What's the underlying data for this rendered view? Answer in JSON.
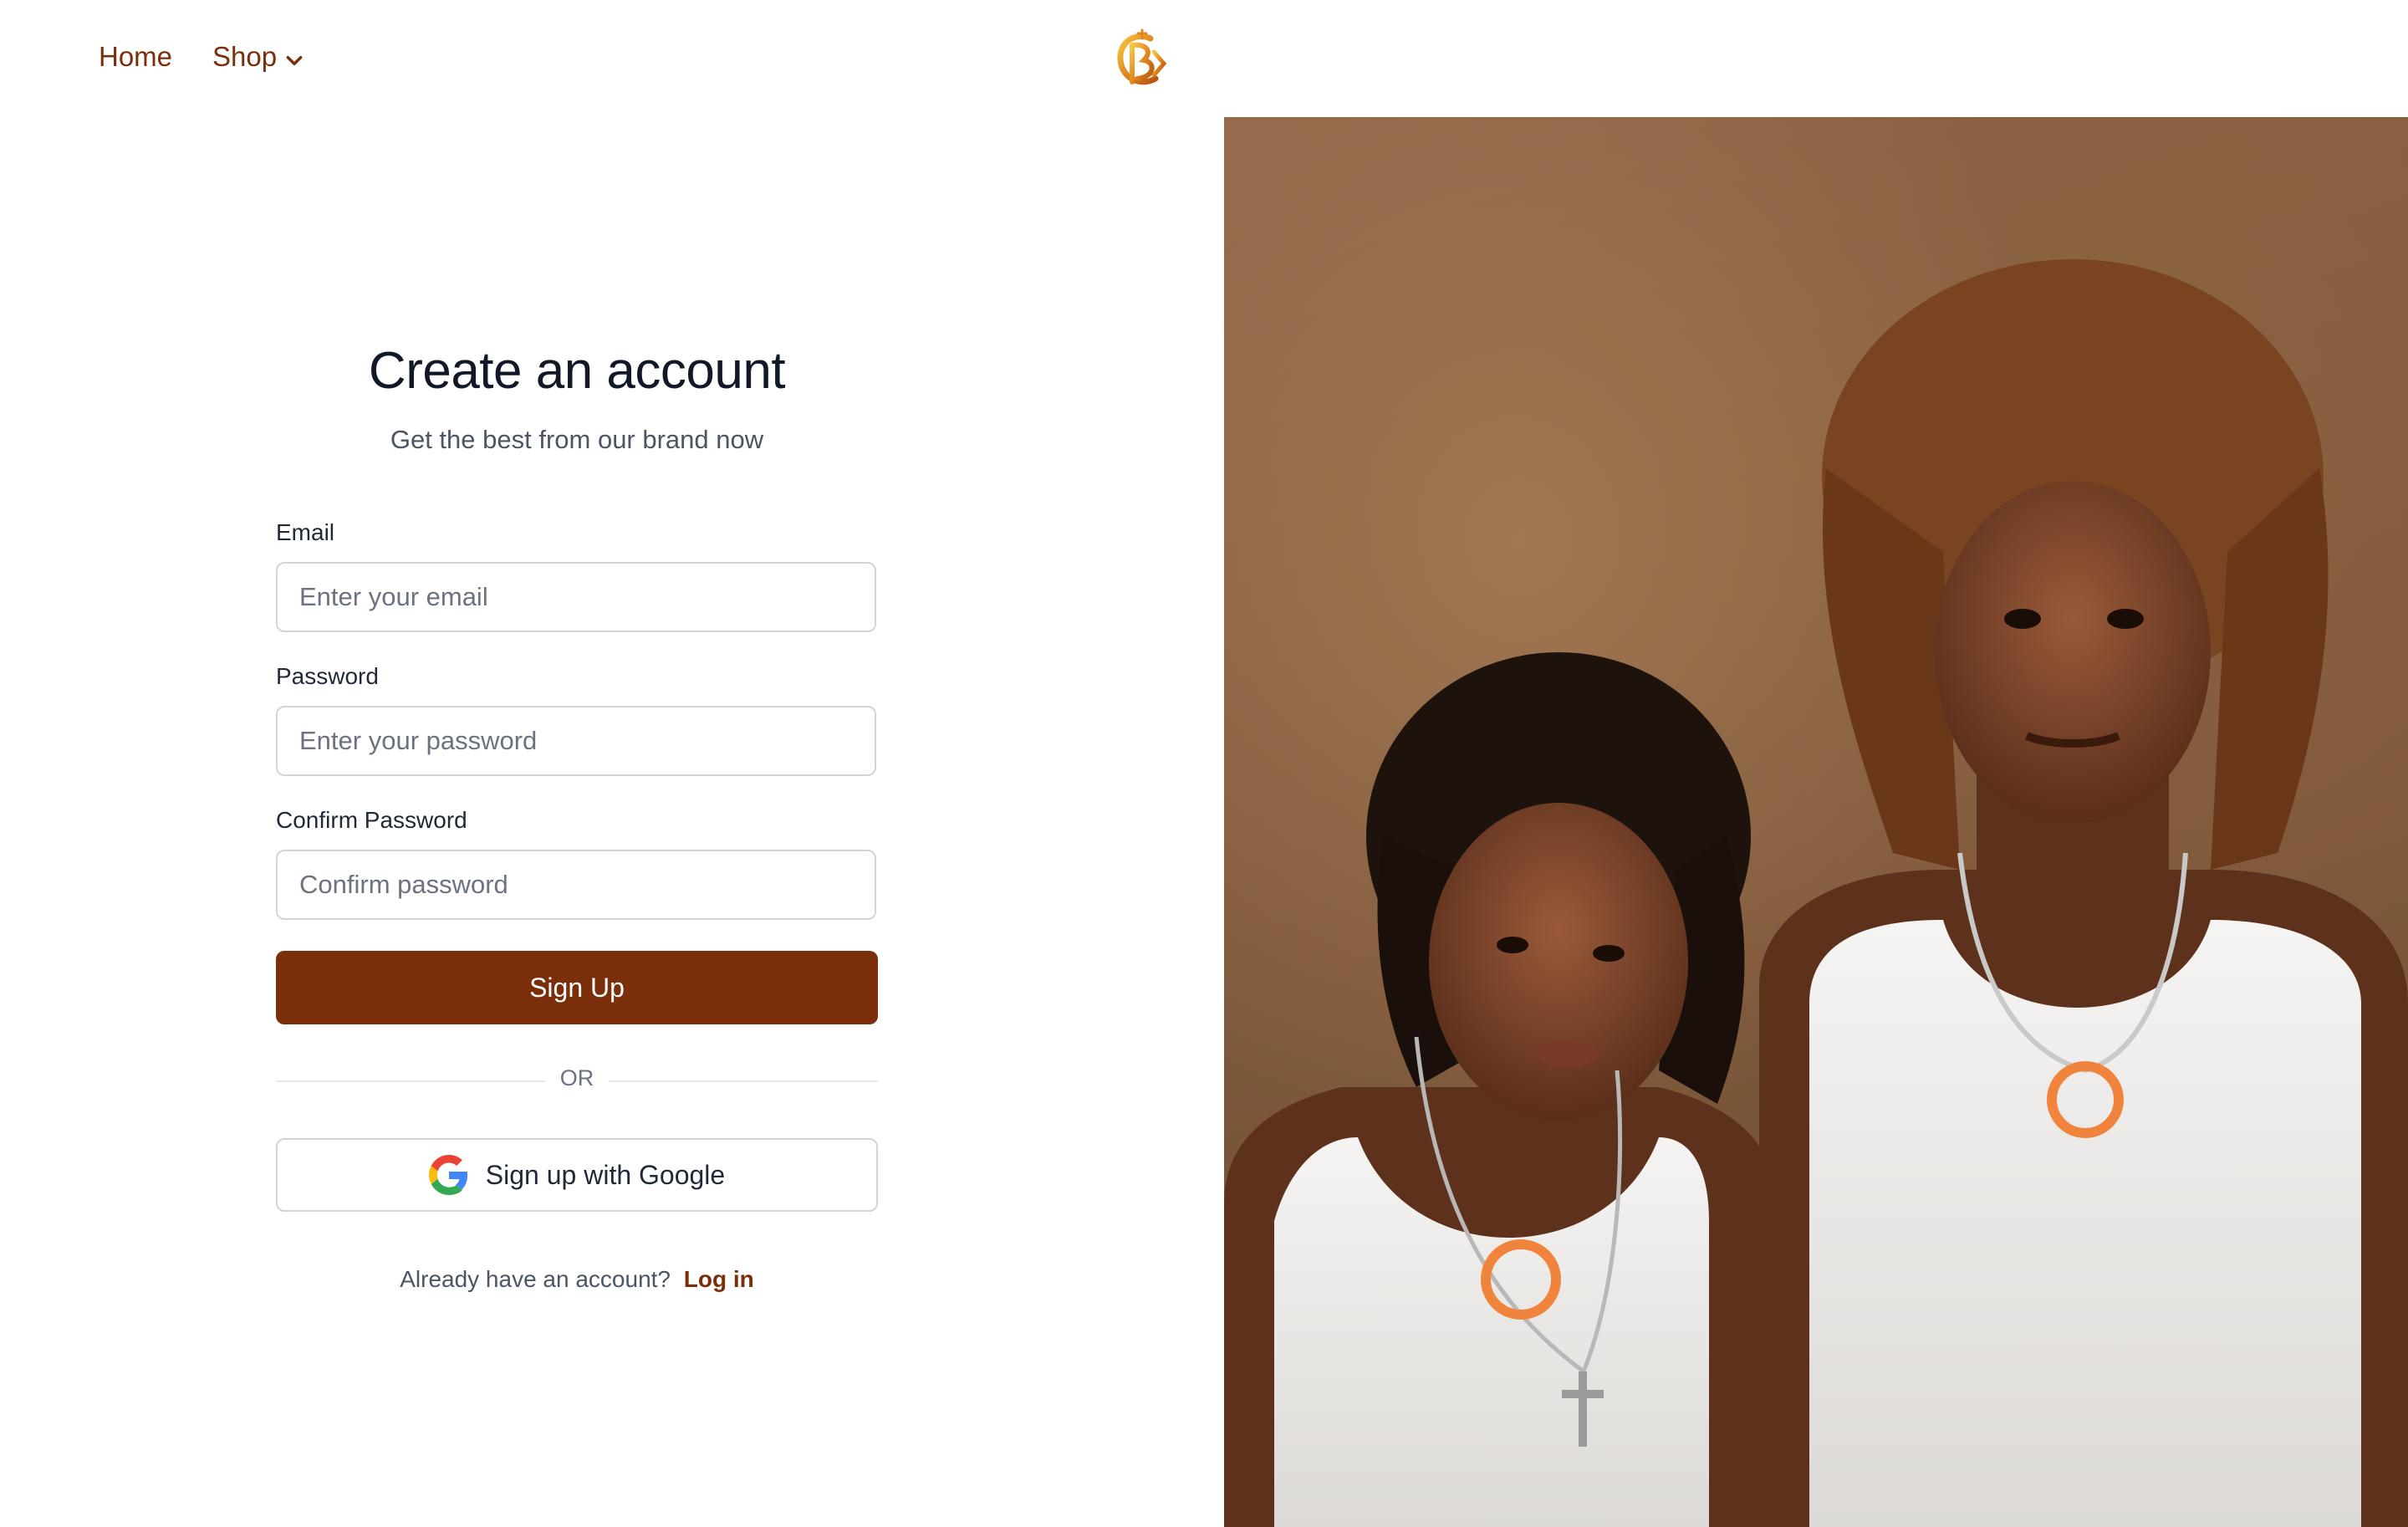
{
  "nav": {
    "home_label": "Home",
    "shop_label": "Shop",
    "logo_icon": "brand-monogram-logo"
  },
  "form": {
    "title": "Create an account",
    "subtitle": "Get the best from our brand now",
    "email_label": "Email",
    "email_placeholder": "Enter your email",
    "password_label": "Password",
    "password_placeholder": "Enter your password",
    "confirm_label": "Confirm Password",
    "confirm_placeholder": "Confirm password",
    "signup_label": "Sign Up",
    "or_text": "OR",
    "google_label": "Sign up with Google",
    "have_account_text": "Already have an account?",
    "login_label": "Log in"
  },
  "colors": {
    "brand": "#7a2e0a",
    "border": "#d1d5db",
    "text_muted": "#4b5563"
  }
}
